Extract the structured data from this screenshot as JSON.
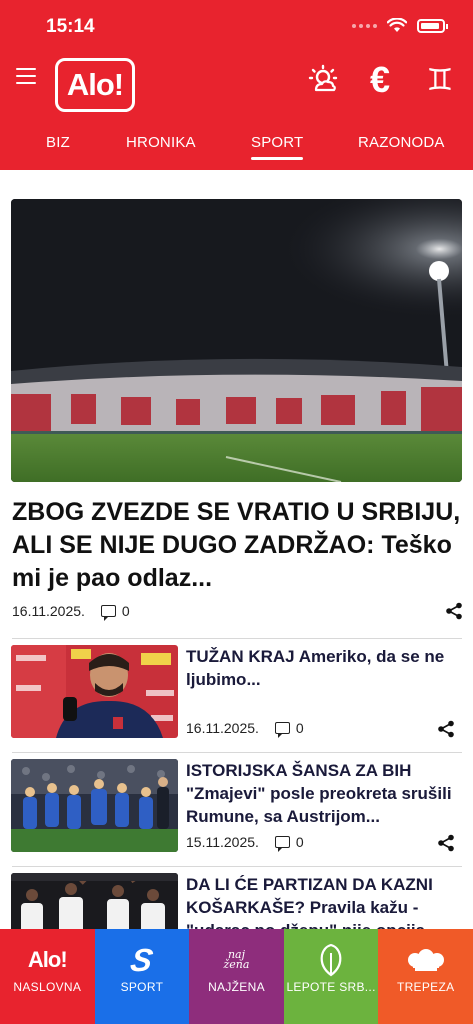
{
  "status_bar": {
    "time": "15:14"
  },
  "header": {
    "logo_text": "Alo!",
    "brand_color": "#e8232e",
    "icons": [
      "menu-icon",
      "weather-icon",
      "euro-icon",
      "zodiac-icon"
    ],
    "euro_glyph": "€",
    "zodiac_glyph": "♊"
  },
  "nav_tabs": [
    {
      "label": "BIZ",
      "active": false
    },
    {
      "label": "HRONIKA",
      "active": false
    },
    {
      "label": "SPORT",
      "active": true
    },
    {
      "label": "RAZONODA",
      "active": false
    }
  ],
  "hero": {
    "title": "ZBOG ZVEZDE SE VRATIO U SRBIJU, ALI SE NIJE DUGO ZADRŽAO: Teško mi je pao odlaz...",
    "date": "16.11.2025.",
    "comments": "0"
  },
  "articles": [
    {
      "title": "TUŽAN KRAJ Ameriko, da se ne ljubimo...",
      "date": "16.11.2025.",
      "comments": "0"
    },
    {
      "title": "ISTORIJSKA ŠANSA ZA BIH \"Zmajevi\" posle preokreta srušili Rumune, sa Austrijom...",
      "date": "15.11.2025.",
      "comments": "0"
    },
    {
      "title": "DA LI ĆE PARTIZAN DA KAZNI KOŠARKAŠE? Pravila kažu - \"udarac po džepu\" nije opcija",
      "date": "",
      "comments": ""
    }
  ],
  "bottom_nav": [
    {
      "label": "NASLOVNA",
      "icon": "alo-logo-icon",
      "color": "#e8232e",
      "icon_text": "Alo!"
    },
    {
      "label": "SPORT",
      "icon": "sport-s-icon",
      "color": "#1a6fe8",
      "icon_text": "S"
    },
    {
      "label": "NAJŽENA",
      "icon": "najzena-icon",
      "color": "#8e2d7c",
      "icon_text": "naj žena"
    },
    {
      "label": "LEPOTE SRB...",
      "icon": "leaf-icon",
      "color": "#6cb33e",
      "icon_text": ""
    },
    {
      "label": "TREPEZA",
      "icon": "chef-hat-icon",
      "color": "#f05a28",
      "icon_text": ""
    }
  ]
}
